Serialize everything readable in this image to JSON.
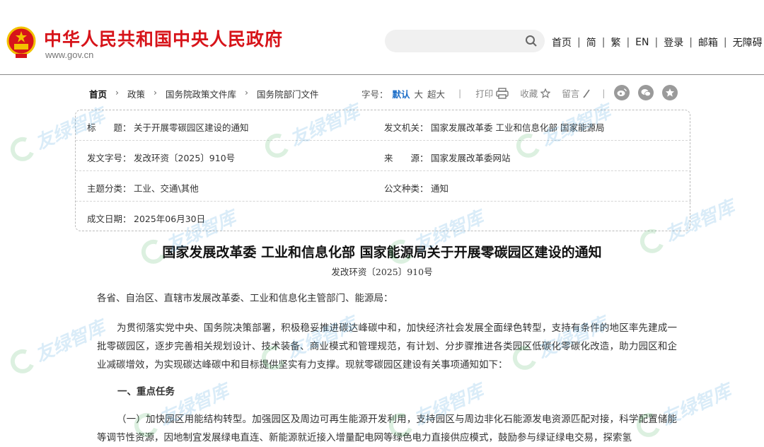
{
  "header": {
    "site_title": "中华人民共和国中央人民政府",
    "site_domain": "www.gov.cn",
    "search_placeholder": "",
    "nav": [
      "首页",
      "简",
      "繁",
      "EN",
      "登录",
      "邮箱",
      "无障碍"
    ]
  },
  "breadcrumb": {
    "items": [
      "首页",
      "政策",
      "国务院政策文件库",
      "国务院部门文件"
    ],
    "arrow": "›"
  },
  "font_size": {
    "label": "字号：",
    "options": [
      "默认",
      "大",
      "超大"
    ],
    "active": "默认"
  },
  "tools": {
    "print": "打印",
    "favorite": "收藏",
    "comment": "留言"
  },
  "info": {
    "title_label": "标　　题：",
    "title_value": "关于开展零碳园区建设的通知",
    "issuer_label": "发文机关：",
    "issuer_value": "国家发展改革委  工业和信息化部  国家能源局",
    "doc_no_label": "发文字号：",
    "doc_no_value": "发改环资〔2025〕910号",
    "source_label": "来　　源：",
    "source_value": "国家发展改革委网站",
    "category_label": "主题分类：",
    "category_value": "工业、交通\\其他",
    "type_label": "公文种类：",
    "type_value": "通知",
    "date_label": "成文日期：",
    "date_value": "2025年06月30日"
  },
  "document": {
    "title": "国家发展改革委  工业和信息化部  国家能源局关于开展零碳园区建设的通知",
    "number": "发改环资〔2025〕910号",
    "salutation": "各省、自治区、直辖市发展改革委、工业和信息化主管部门、能源局：",
    "intro": "为贯彻落实党中央、国务院决策部署，积极稳妥推进碳达峰碳中和，加快经济社会发展全面绿色转型，支持有条件的地区率先建成一批零碳园区，逐步完善相关规划设计、技术装备、商业模式和管理规范，有计划、分步骤推进各类园区低碳化零碳化改造，助力园区和企业减碳增效，为实现碳达峰碳中和目标提供坚实有力支撑。现就零碳园区建设有关事项通知如下：",
    "heading_1": "一、重点任务",
    "body_1": "（一）加快园区用能结构转型。加强园区及周边可再生能源开发利用，支持园区与周边非化石能源发电资源匹配对接，科学配置储能等调节性资源，因地制宜发展绿电直连、新能源就近接入增量配电网等绿色电力直接供应模式，鼓励参与绿证绿电交易，探索氢"
  },
  "watermark": "友绿智库",
  "colors": {
    "brand_red": "#d7141a",
    "active_blue": "#1e6fc8",
    "watermark_green": "#2aa845",
    "watermark_blue": "#1f8fd6"
  }
}
